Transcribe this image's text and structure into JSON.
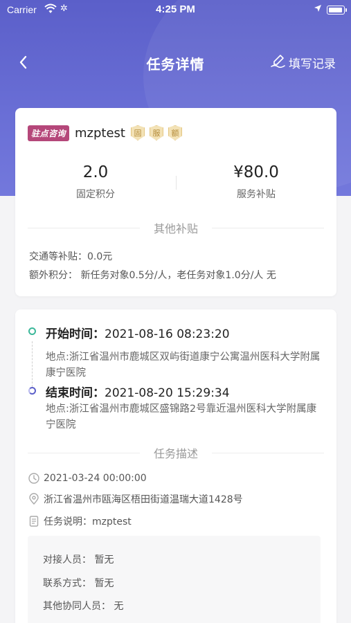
{
  "status_bar": {
    "carrier": "Carrier",
    "time": "4:25 PM"
  },
  "nav": {
    "title": "任务详情",
    "record_label": "填写记录"
  },
  "summary": {
    "type_tag": "驻点咨询",
    "task_name": "mzptest",
    "badges": [
      "固",
      "服",
      "额"
    ],
    "fixed_points_value": "2.0",
    "fixed_points_label": "固定积分",
    "subsidy_value": "¥80.0",
    "subsidy_label": "服务补贴",
    "other_subsidy_heading": "其他补贴",
    "traffic_subsidy": "交通等补贴：0.0元",
    "extra_points": "额外积分：  新任务对象0.5分/人，老任务对象1.0分/人 无"
  },
  "timeline": {
    "start_label": "开始时间：",
    "start_time": "2021-08-16 08:23:20",
    "start_address": "地点:浙江省温州市鹿城区双屿街道康宁公寓温州医科大学附属康宁医院",
    "end_label": "结束时间：",
    "end_time": "2021-08-20 15:29:34",
    "end_address": "地点:浙江省温州市鹿城区盛锦路2号靠近温州医科大学附属康宁医院"
  },
  "description": {
    "heading": "任务描述",
    "datetime": "2021-03-24 00:00:00",
    "location": "浙江省温州市瓯海区梧田街道温瑞大道1428号",
    "task_note": "任务说明：mzptest"
  },
  "contacts": {
    "contact_person": "对接人员：  暂无",
    "contact_method": "联系方式：  暂无",
    "other_staff": "其他协同人员：  无"
  },
  "colors": {
    "accent": "#5b5fc9",
    "tag_bg": "#b5477a",
    "start_dot": "#3cb89a"
  }
}
